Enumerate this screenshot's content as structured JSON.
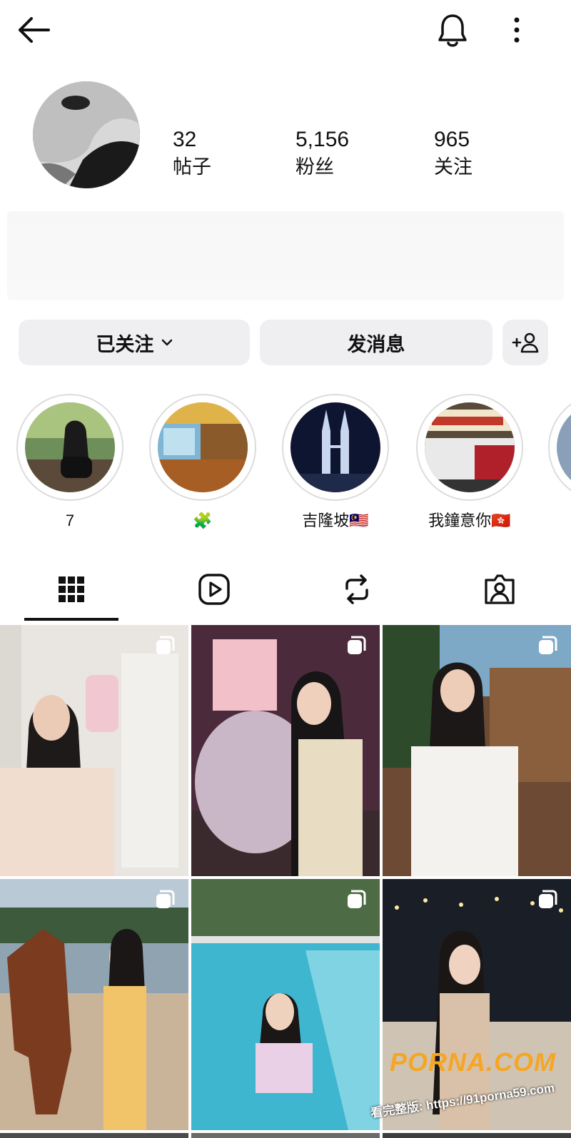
{
  "header": {
    "back_icon": "arrow-left-icon",
    "notification_icon": "bell-icon",
    "more_icon": "more-vertical-icon"
  },
  "profile": {
    "stats": [
      {
        "value": "32",
        "label": "帖子"
      },
      {
        "value": "5,156",
        "label": "粉丝"
      },
      {
        "value": "965",
        "label": "关注"
      }
    ]
  },
  "actions": {
    "following_label": "已关注",
    "message_label": "发消息",
    "add_user_icon": "add-user-icon"
  },
  "highlights": [
    {
      "caption": "7"
    },
    {
      "caption": "🧩"
    },
    {
      "caption": "吉隆坡🇲🇾"
    },
    {
      "caption": "我鐘意你🇭🇰"
    }
  ],
  "tabs": [
    {
      "icon": "grid-icon",
      "active": true
    },
    {
      "icon": "reels-icon",
      "active": false
    },
    {
      "icon": "repost-icon",
      "active": false
    },
    {
      "icon": "tagged-icon",
      "active": false
    }
  ],
  "watermark": {
    "logo": "PORNA.COM",
    "url": "看完整版: https://91porna59.com"
  },
  "colors": {
    "button_bg": "#efeff2",
    "text": "#111111",
    "watermark": "#f5a623"
  }
}
